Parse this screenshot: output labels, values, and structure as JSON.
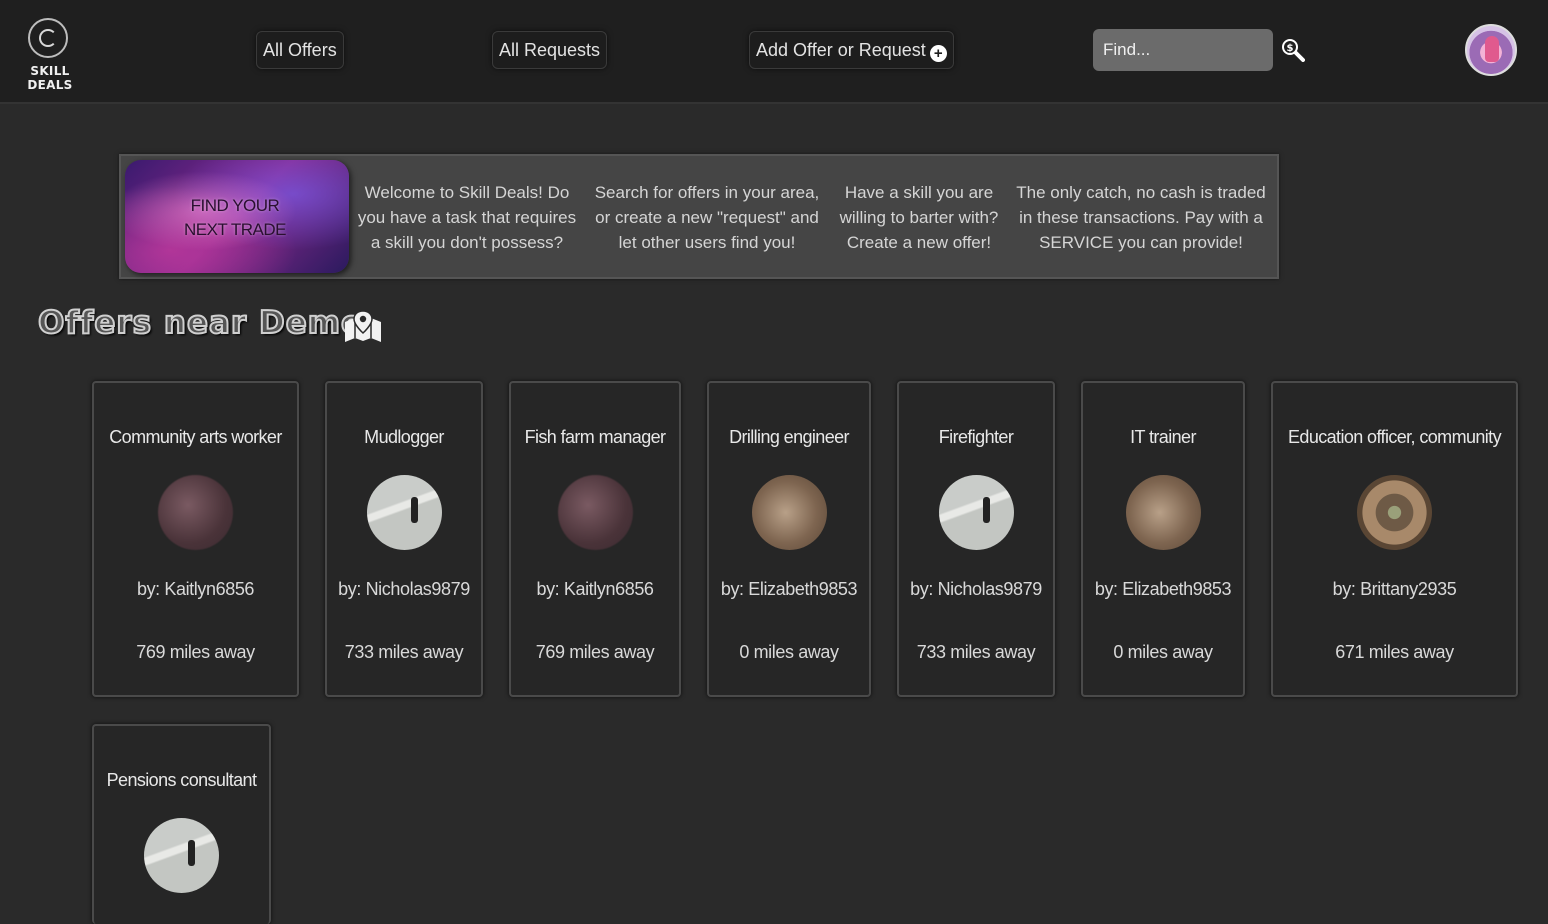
{
  "app": {
    "logo_text": "SKILL DEALS"
  },
  "nav": {
    "all_offers": "All Offers",
    "all_requests": "All Requests",
    "add_offer_or_request": "Add Offer or Request"
  },
  "search": {
    "placeholder": "Find..."
  },
  "banner": {
    "image_text": "FIND YOUR NEXT TRADE",
    "col1": "Welcome to Skill Deals! Do you have a task that requires a skill you don't possess?",
    "col2": "Search for offers in your area, or create a new \"request\" and let other users find you!",
    "col3": "Have a skill you are willing to barter with? Create a new offer!",
    "col4": "The only catch, no cash is traded in these transactions. Pay with a SERVICE you can provide!"
  },
  "section": {
    "title": "Offers near Demo"
  },
  "offers": [
    {
      "title": "Community arts worker",
      "owner": "by: Kaitlyn6856",
      "distance": "769 miles away"
    },
    {
      "title": "Mudlogger",
      "owner": "by: Nicholas9879",
      "distance": "733 miles away"
    },
    {
      "title": "Fish farm manager",
      "owner": "by: Kaitlyn6856",
      "distance": "769 miles away"
    },
    {
      "title": "Drilling engineer",
      "owner": "by: Elizabeth9853",
      "distance": "0 miles away"
    },
    {
      "title": "Firefighter",
      "owner": "by: Nicholas9879",
      "distance": "733 miles away"
    },
    {
      "title": "IT trainer",
      "owner": "by: Elizabeth9853",
      "distance": "0 miles away"
    },
    {
      "title": "Education officer, community",
      "owner": "by: Brittany2935",
      "distance": "671 miles away"
    },
    {
      "title": "Pensions consultant",
      "owner": "",
      "distance": ""
    }
  ],
  "icons": {
    "search": "magnifier-dollar-icon",
    "add": "plus-circle-icon",
    "map": "map-pin-icon"
  }
}
